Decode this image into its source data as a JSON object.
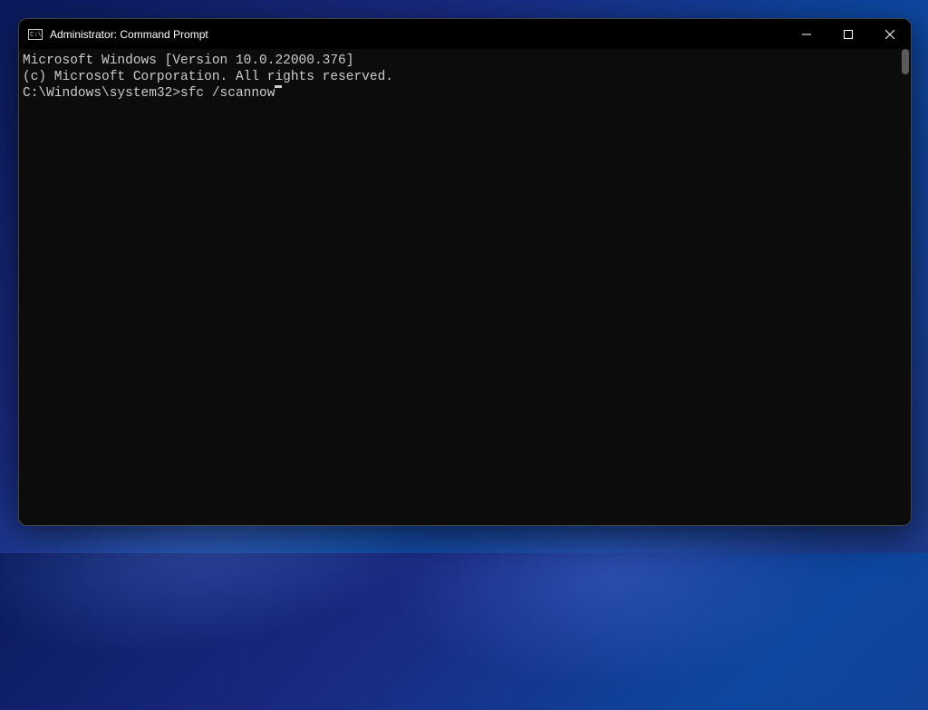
{
  "window": {
    "title": "Administrator: Command Prompt"
  },
  "terminal": {
    "line1": "Microsoft Windows [Version 10.0.22000.376]",
    "line2": "(c) Microsoft Corporation. All rights reserved.",
    "blank": "",
    "prompt": "C:\\Windows\\system32>",
    "command": "sfc /scannow"
  }
}
